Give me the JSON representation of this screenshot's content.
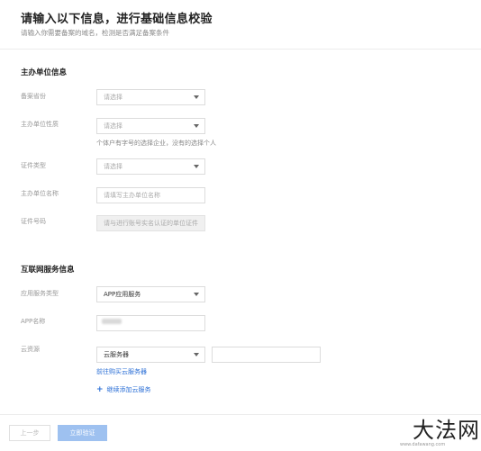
{
  "header": {
    "title": "请输入以下信息，进行基础信息校验",
    "subtitle": "请输入你需要备案的域名，检测是否满足备案条件"
  },
  "sponsor": {
    "section_title": "主办单位信息",
    "province": {
      "label": "备案省份",
      "placeholder": "请选择"
    },
    "nature": {
      "label": "主办单位性质",
      "placeholder": "请选择",
      "hint": "个体户有字号的选择企业，没有的选择个人"
    },
    "cert_type": {
      "label": "证件类型",
      "placeholder": "请选择"
    },
    "name": {
      "label": "主办单位名称",
      "placeholder": "请填写主办单位名称"
    },
    "cert_no": {
      "label": "证件号码",
      "placeholder": "请与进行账号实名认证的单位证件"
    }
  },
  "internet": {
    "section_title": "互联网服务信息",
    "service_type": {
      "label": "应用服务类型",
      "value": "APP应用服务"
    },
    "app_name": {
      "label": "APP名称"
    },
    "cloud": {
      "label": "云资源",
      "value": "云服务器",
      "buy_link": "前往购买云服务器",
      "add_link": "继续添加云服务"
    }
  },
  "footer": {
    "prev": "上一步",
    "verify": "立即验证"
  },
  "watermark": {
    "text": "大法网",
    "small": "www.dafawang.com"
  },
  "icons": {
    "caret": "chevron-down-icon",
    "plus": "plus-icon"
  },
  "colors": {
    "link": "#2b6fd6",
    "primary_disabled": "#9ec1f0"
  }
}
